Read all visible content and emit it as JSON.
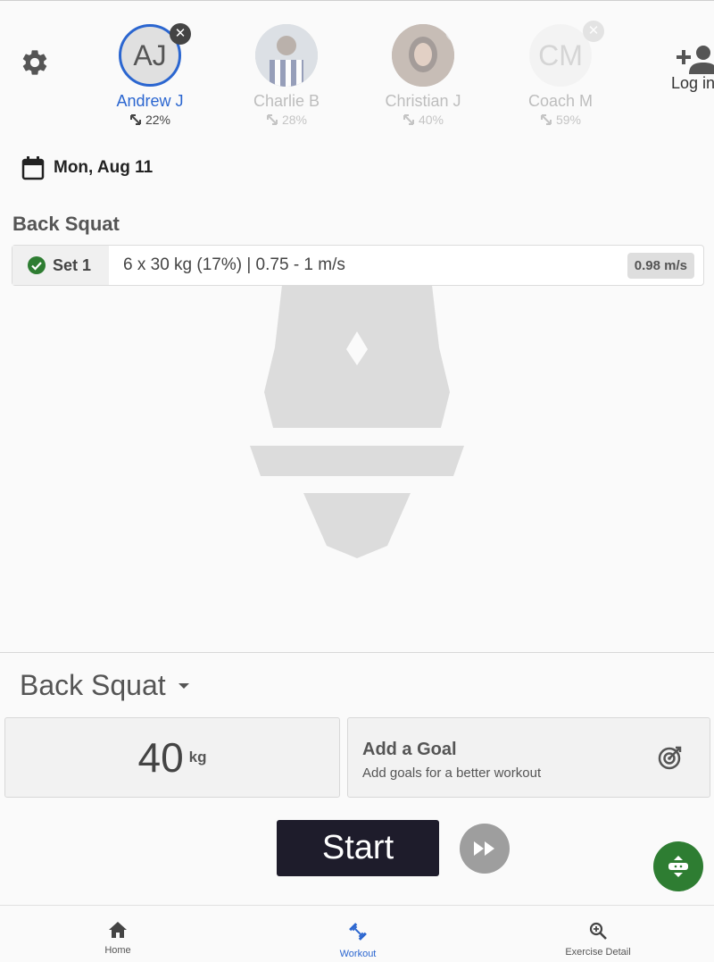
{
  "athletes": [
    {
      "initials": "AJ",
      "name": "Andrew J",
      "percent": "22%",
      "selected": true,
      "photo": false
    },
    {
      "initials": "",
      "name": "Charlie B",
      "percent": "28%",
      "selected": false,
      "photo": true
    },
    {
      "initials": "",
      "name": "Christian J",
      "percent": "40%",
      "selected": false,
      "photo": true
    },
    {
      "initials": "CM",
      "name": "Coach M",
      "percent": "59%",
      "selected": false,
      "photo": false
    }
  ],
  "login_label": "Log in",
  "date": "Mon, Aug 11",
  "exercise": {
    "title": "Back Squat",
    "set_label": "Set 1",
    "set_detail": "6 x 30 kg (17%)  |  0.75 - 1 m/s",
    "set_velocity": "0.98 m/s"
  },
  "panel": {
    "exercise_select": "Back Squat",
    "weight_value": "40",
    "weight_unit": "kg",
    "goal_title": "Add a Goal",
    "goal_subtitle": "Add goals for a better workout",
    "start_label": "Start"
  },
  "nav": {
    "home": "Home",
    "workout": "Workout",
    "exercise_detail": "Exercise Detail"
  },
  "colors": {
    "accent": "#2b66d0",
    "start_button": "#1e1c2b",
    "device_button": "#2e7d32",
    "set_complete": "#2e7d32"
  }
}
